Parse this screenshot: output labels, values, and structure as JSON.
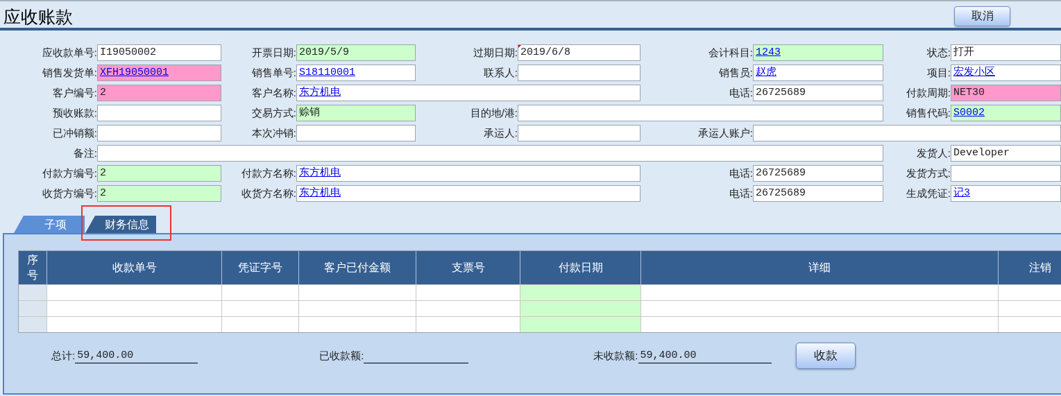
{
  "title": "应收账款",
  "cancel_button": "取消",
  "form_rows": [
    [
      {
        "label": "应收款单号:",
        "value": "I19050002",
        "color": "#ffffff"
      },
      {
        "label": "开票日期:",
        "value": "2019/5/9",
        "color": "#ccffcc"
      },
      {
        "label": "过期日期:",
        "value": "2019/6/8",
        "color": "#ffffff",
        "flagged": true
      },
      {
        "label": "会计科目:",
        "value": "1243",
        "color": "#ccffcc",
        "link": true
      },
      {
        "label": "状态:",
        "value": "打开",
        "color": "#ffffff"
      }
    ],
    [
      {
        "label": "销售发货单:",
        "value": "XFH19050001",
        "color": "#ff99cc",
        "link": true
      },
      {
        "label": "销售单号:",
        "value": "S18110001",
        "color": "#ffffff",
        "link": true
      },
      {
        "label": "联系人:",
        "color": "#ffffff"
      },
      {
        "label": "销售员:",
        "value": "赵虎",
        "color": "#ffffff",
        "link": true
      },
      {
        "label": "项目:",
        "value": "宏发小区",
        "color": "#ffffff",
        "link": true
      }
    ],
    [
      {
        "label": "客户编号:",
        "value": "2",
        "color": "#ff99cc"
      },
      {
        "label": "客户名称:",
        "value": "东方机电",
        "color": "#ffffff",
        "link": true
      },
      {
        "label": "电话:",
        "value": "26725689",
        "color": "#ffffff"
      },
      {
        "label": "付款周期:",
        "value": "NET30",
        "color": "#ff99cc"
      }
    ],
    [
      {
        "label": "预收账款:",
        "color": "#ffffff"
      },
      {
        "label": "交易方式:",
        "value": "赊销",
        "color": "#ccffcc"
      },
      {
        "label": "目的地/港:",
        "color": "#ffffff"
      },
      {
        "label": "销售代码:",
        "value": "S0002",
        "color": "#ccffcc",
        "link": true
      }
    ],
    [
      {
        "label": "已冲销额:",
        "color": "#ffffff"
      },
      {
        "label": "本次冲销:",
        "color": "#ffffff"
      },
      {
        "label": "承运人:",
        "color": "#ffffff"
      },
      {
        "label": "承运人账户:",
        "color": "#ffffff"
      }
    ],
    [
      {
        "label": "备注:",
        "color": "#ffffff"
      },
      {
        "label": "发货人:",
        "value": "Developer",
        "color": "#ffffff"
      }
    ],
    [
      {
        "label": "付款方编号:",
        "value": "2",
        "color": "#ccffcc"
      },
      {
        "label": "付款方名称:",
        "value": "东方机电",
        "color": "#ffffff",
        "link": true
      },
      {
        "label": "电话:",
        "value": "26725689",
        "color": "#ffffff"
      },
      {
        "label": "发货方式:",
        "color": "#ffffff"
      }
    ],
    [
      {
        "label": "收货方编号:",
        "value": "2",
        "color": "#ccffcc"
      },
      {
        "label": "收货方名称:",
        "value": "东方机电",
        "color": "#ffffff",
        "link": true
      },
      {
        "label": "电话:",
        "value": "26725689",
        "color": "#ffffff"
      },
      {
        "label": "生成凭证:",
        "value": "记3",
        "color": "#ffffff",
        "link": true
      }
    ]
  ],
  "tabs": [
    {
      "label": "子项",
      "selected": false,
      "highlighted": false
    },
    {
      "label": "财务信息",
      "selected": true,
      "highlighted": true
    }
  ],
  "table": {
    "columns": [
      {
        "label": "序号",
        "color": "#dce6f1"
      },
      {
        "label": "收款单号",
        "color": "#ffffff"
      },
      {
        "label": "凭证字号",
        "color": "#ffffff"
      },
      {
        "label": "客户已付金额",
        "color": "#ffffff"
      },
      {
        "label": "支票号",
        "color": "#ffffff"
      },
      {
        "label": "付款日期",
        "color": "#ccffcc"
      },
      {
        "label": "详细",
        "color": "#ffffff"
      },
      {
        "label": "注销",
        "color": "#ffffff"
      }
    ]
  },
  "totals": [
    {
      "label": "总计:",
      "value": "59,400.00"
    },
    {
      "label": "已收款额:"
    },
    {
      "label": "未收款额:",
      "value": "59,400.00"
    }
  ],
  "collect_button": "收款"
}
